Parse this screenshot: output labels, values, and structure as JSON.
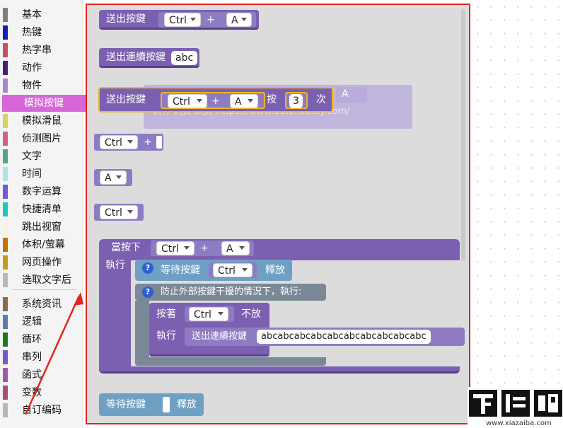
{
  "sidebar": {
    "categories": [
      {
        "label": "基本",
        "color": "#7f7f7f"
      },
      {
        "label": "热键",
        "color": "#1a1ab5"
      },
      {
        "label": "热字串",
        "color": "#c9505e"
      },
      {
        "label": "动作",
        "color": "#4b1d7a"
      },
      {
        "label": "物件",
        "color": "#a985d6"
      },
      {
        "label": "模拟按键",
        "color": "#d966d9"
      },
      {
        "label": "模拟滑鼠",
        "color": "#d5d55a"
      },
      {
        "label": "侦测图片",
        "color": "#d35f8c"
      },
      {
        "label": "文字",
        "color": "#5aa383"
      },
      {
        "label": "时间",
        "color": "#a9e5e8"
      },
      {
        "label": "数字运算",
        "color": "#6e5ad9"
      },
      {
        "label": "快捷清单",
        "color": "#1cc7c2"
      },
      {
        "label": "跳出视窗",
        "color": "#f6f2e4"
      },
      {
        "label": "体积/萤幕",
        "color": "#c27400"
      },
      {
        "label": "网页操作",
        "color": "#c99a1a"
      },
      {
        "label": "选取文字后",
        "color": "#b8b8b8"
      },
      {
        "label": "系统资讯",
        "color": "#8a6a4a"
      },
      {
        "label": "逻辑",
        "color": "#5b7fa6"
      },
      {
        "label": "循环",
        "color": "#1b7a1b"
      },
      {
        "label": "串列",
        "color": "#7a56c9"
      },
      {
        "label": "函式",
        "color": "#9f5aa8"
      },
      {
        "label": "变数",
        "color": "#a64f7a"
      },
      {
        "label": "自订编码",
        "color": "#b6b6b6"
      }
    ],
    "selected_index": 5
  },
  "blocks": {
    "send_keys_label": "送出按鍵",
    "plus": "+",
    "ctrl": "Ctrl",
    "a": "A",
    "send_seq_label": "送出連續按鍵",
    "seq_value": "abc",
    "press_word": "按",
    "times_value": "3",
    "times_word": "次",
    "ghost_text": "執行 網頁 網頁 https://www.autohotkey.com/",
    "on_press_label": "當按下",
    "exec_label": "執行",
    "wait_key_label": "等待按鍵",
    "release_label": "釋放",
    "prevent_label": "防止外部按鍵干擾的情況下，執行:",
    "hold_label": "按著",
    "not_release_label": "不放",
    "inner_exec_label": "執行",
    "long_seq_value": "abcabcabcabcabcabcabcabcabcabc",
    "help_glyph": "?"
  },
  "watermark": {
    "brand": "下载吧",
    "url": "www.xiazaiba.com"
  },
  "colors": {
    "highlight_frame": "#e0251f",
    "selected_block_outline": "#f1b321",
    "block_purple": "#7b5fb0",
    "block_teal": "#6fa0c4",
    "block_slate": "#7a8898"
  }
}
